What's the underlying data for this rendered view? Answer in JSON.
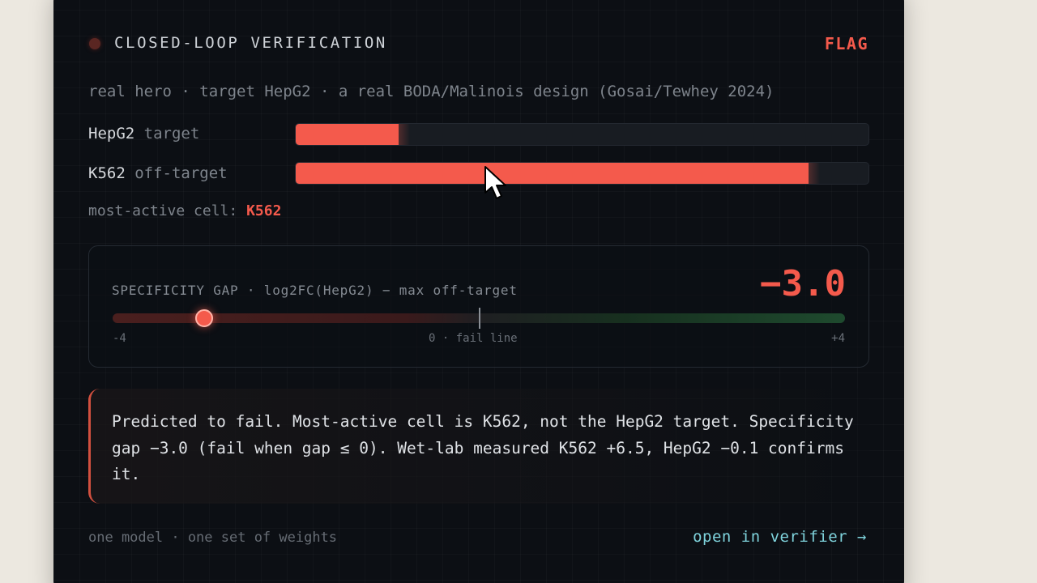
{
  "header": {
    "title": "CLOSED-LOOP VERIFICATION",
    "status": "FLAG",
    "subtitle": "real hero · target HepG2 · a real BODA/Malinois design (Gosai/Tewhey 2024)"
  },
  "activity": {
    "rows": [
      {
        "cell": "HepG2",
        "role": "target",
        "fraction": 0.18
      },
      {
        "cell": "K562",
        "role": "off-target",
        "fraction": 0.895
      }
    ],
    "most_active_label": "most-active cell:",
    "most_active_value": "K562"
  },
  "gap": {
    "title": "SPECIFICITY GAP · log2FC(HepG2) − max off-target",
    "value_text": "−3.0",
    "value": -3.0,
    "min": -4,
    "max": 4,
    "min_label": "-4",
    "center_label": "0 · fail line",
    "max_label": "+4"
  },
  "verdict": {
    "text": "Predicted to fail. Most-active cell is K562, not the HepG2 target. Specificity gap −3.0 (fail when gap ≤ 0). Wet-lab measured K562 +6.5, HepG2 −0.1 confirms it."
  },
  "footer": {
    "note": "one model · one set of weights",
    "link": "open in verifier →"
  },
  "colors": {
    "accent_red": "#f45a4c",
    "link_cyan": "#7fd3dc",
    "card_bg": "#0c0f14",
    "page_bg": "#ece8e0"
  },
  "icons": {
    "status_dot": "status-dot",
    "cursor": "mouse-pointer-icon"
  }
}
